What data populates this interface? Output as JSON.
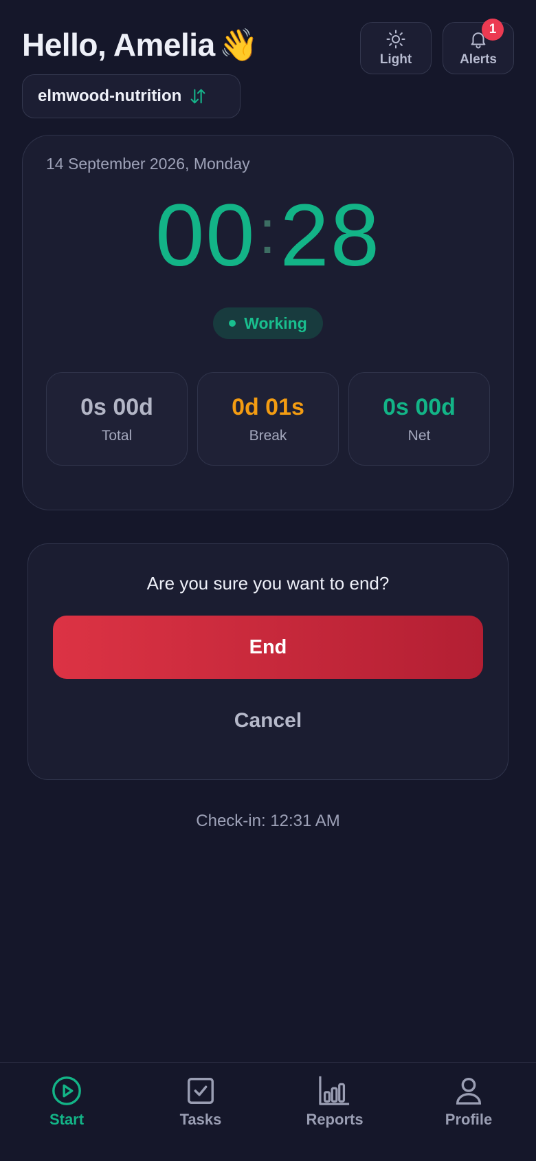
{
  "header": {
    "greeting": "Hello, Amelia",
    "wave": "👋",
    "theme_button_label": "Light",
    "alerts_button_label": "Alerts",
    "alerts_count": "1",
    "org_name": "elmwood-nutrition",
    "org_switch_icon": "swap-vertical-icon"
  },
  "timer": {
    "date": "14 September 2026, Monday",
    "minutes": "00",
    "separator": ":",
    "seconds": "28",
    "status": "Working",
    "stats": {
      "total": {
        "value": "0s 00d",
        "label": "Total"
      },
      "break": {
        "value": "0d 01s",
        "label": "Break"
      },
      "net": {
        "value": "0s 00d",
        "label": "Net"
      }
    }
  },
  "confirm": {
    "question": "Are you sure you want to end?",
    "end_label": "End",
    "cancel_label": "Cancel"
  },
  "checkin": "Check-in: 12:31 AM",
  "nav": {
    "start": "Start",
    "tasks": "Tasks",
    "reports": "Reports",
    "profile": "Profile"
  },
  "colors": {
    "background": "#15172a",
    "accent_green": "#13b487",
    "break_orange": "#f39c12",
    "end_red": "#dc3344",
    "badge_red": "#ec3b52"
  }
}
